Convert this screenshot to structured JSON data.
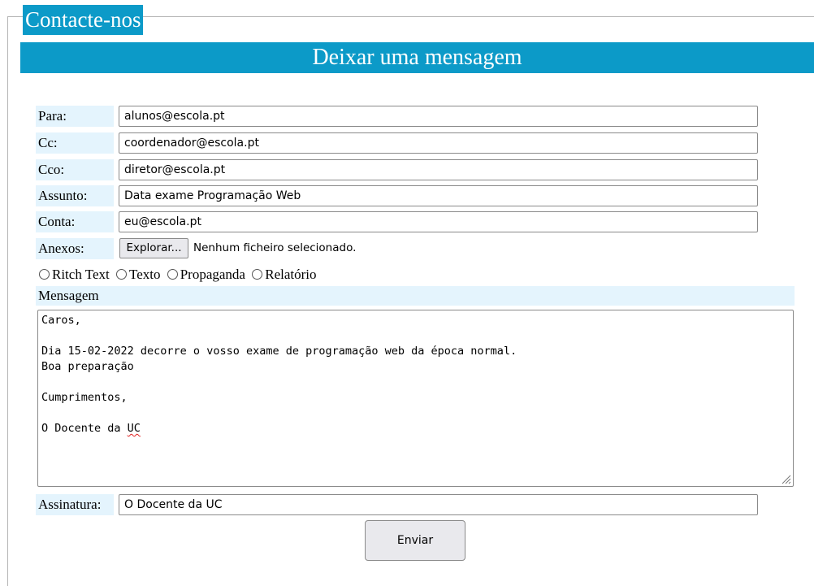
{
  "legend": "Contacte-nos",
  "banner": "Deixar uma mensagem",
  "fields": {
    "para": {
      "label": "Para:",
      "value": "alunos@escola.pt"
    },
    "cc": {
      "label": "Cc:",
      "value": "coordenador@escola.pt"
    },
    "cco": {
      "label": "Cco:",
      "value": "diretor@escola.pt"
    },
    "assunto": {
      "label": "Assunto:",
      "value": "Data exame Programação Web"
    },
    "conta": {
      "label": "Conta:",
      "value": "eu@escola.pt"
    }
  },
  "anexos": {
    "label": "Anexos:",
    "button": "Explorar...",
    "status": "Nenhum ficheiro selecionado."
  },
  "radios": [
    "Ritch Text",
    "Texto",
    "Propaganda",
    "Relatório"
  ],
  "mensagem": {
    "label": "Mensagem",
    "lines": [
      "Caros,",
      "",
      "Dia 15-02-2022 decorre o vosso exame de programação web da época normal.",
      "Boa preparação",
      "",
      "Cumprimentos,",
      "",
      "O Docente da "
    ],
    "last_word": "UC"
  },
  "assinatura": {
    "label": "Assinatura:",
    "value": "O Docente da UC"
  },
  "send_label": "Enviar"
}
